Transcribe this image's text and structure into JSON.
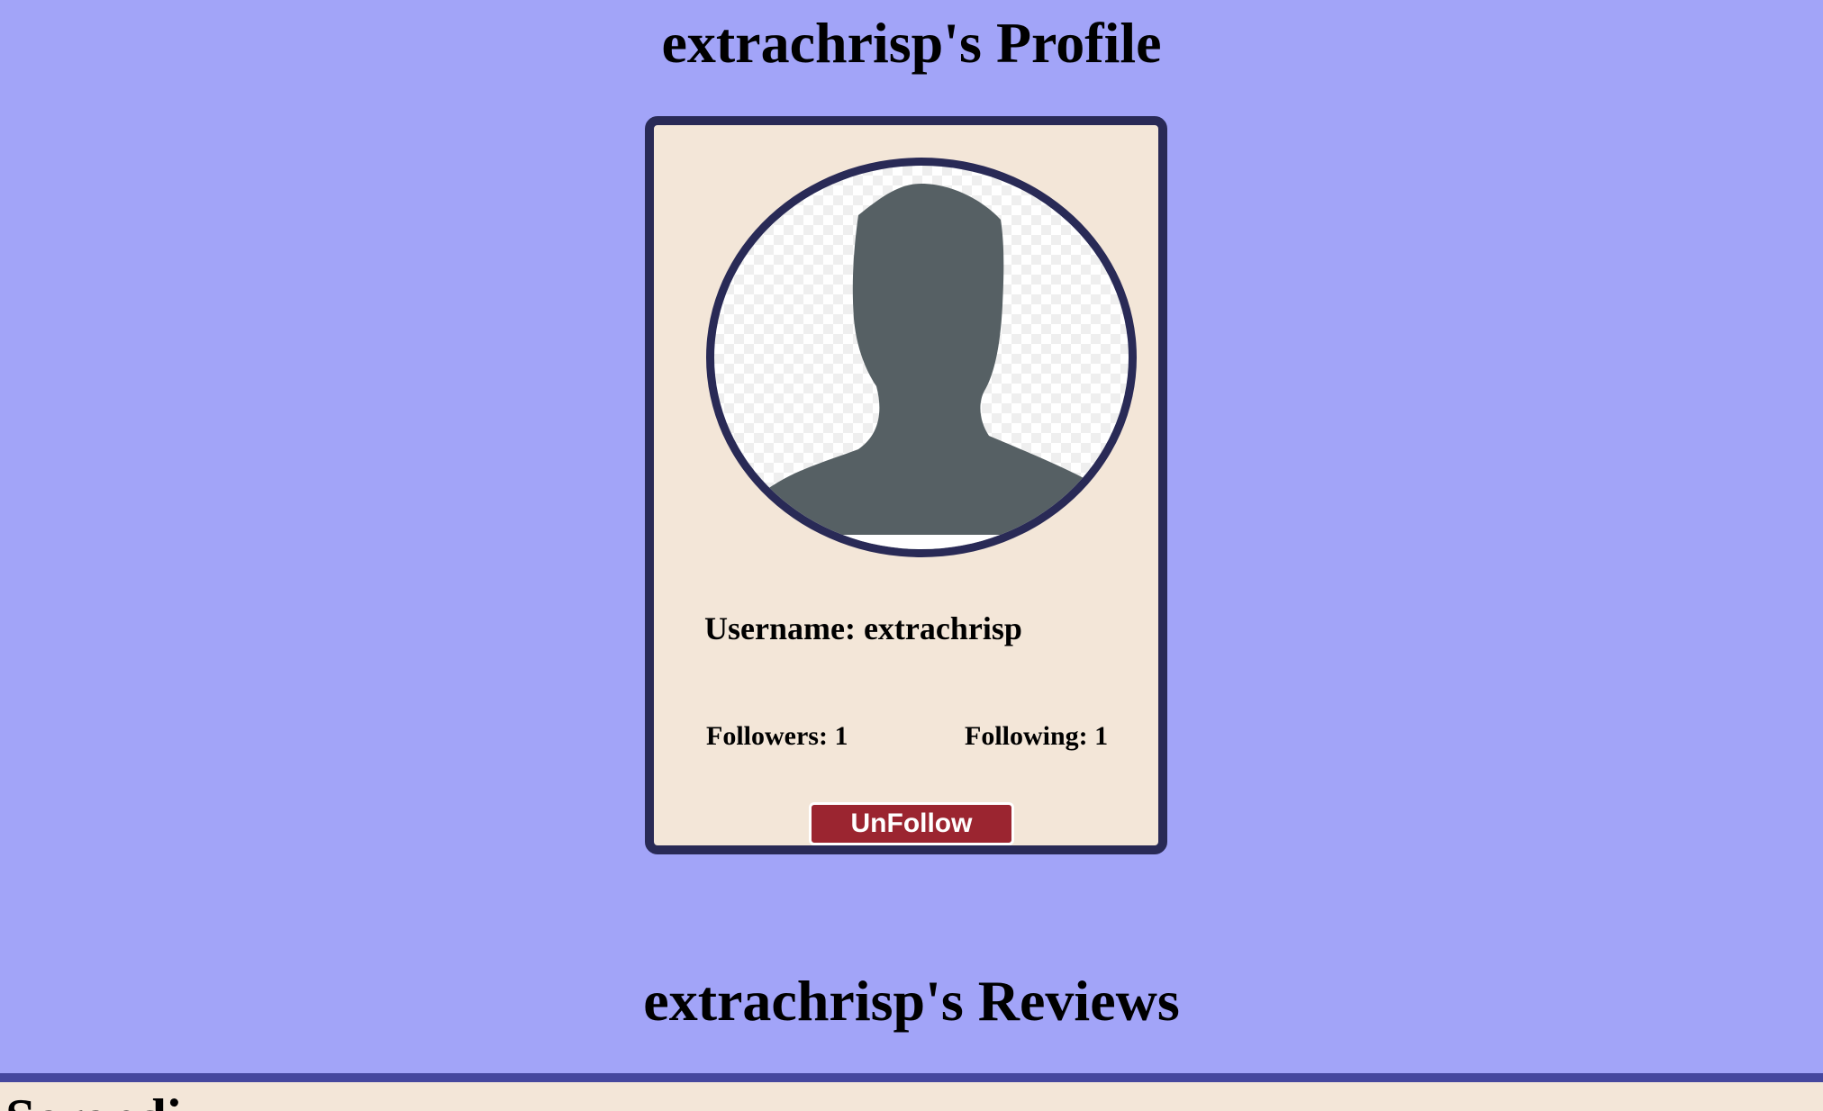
{
  "profile": {
    "title": "extrachrisp's Profile",
    "avatar_icon": "user-silhouette-icon",
    "username_label": "Username: extrachrisp",
    "followers_label": "Followers: 1",
    "following_label": "Following: 1",
    "unfollow_label": "UnFollow"
  },
  "reviews": {
    "title": "extrachrisp's Reviews",
    "first_review_heading": "Serendi"
  },
  "colors": {
    "background": "#a2a4f8",
    "card": "#f3e6d8",
    "card_border": "#292a56",
    "button": "#9b2530",
    "divider": "#45479e",
    "silhouette": "#566064"
  }
}
